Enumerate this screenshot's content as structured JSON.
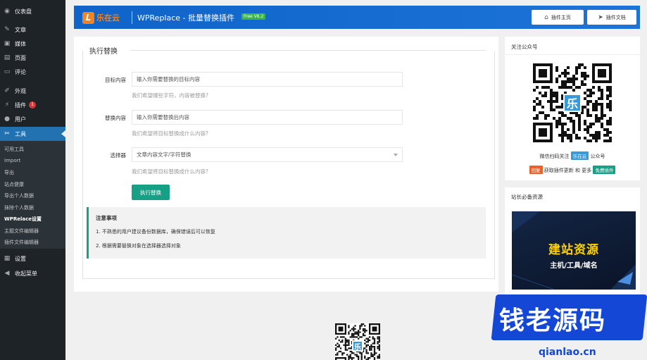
{
  "sidebar": {
    "items": [
      {
        "label": "仪表盘",
        "icon": "dashboard-icon"
      },
      {
        "label": "文章",
        "icon": "pin-icon"
      },
      {
        "label": "媒体",
        "icon": "media-icon"
      },
      {
        "label": "页面",
        "icon": "page-icon"
      },
      {
        "label": "评论",
        "icon": "comment-icon"
      },
      {
        "label": "外观",
        "icon": "brush-icon"
      },
      {
        "label": "插件",
        "icon": "plugin-icon",
        "badge": "1"
      },
      {
        "label": "用户",
        "icon": "user-icon"
      },
      {
        "label": "工具",
        "icon": "wrench-icon",
        "active": true
      },
      {
        "label": "设置",
        "icon": "settings-icon"
      },
      {
        "label": "收起菜单",
        "icon": "collapse-icon"
      }
    ],
    "submenu": [
      "可用工具",
      "Import",
      "导出",
      "站点健康",
      "导出个人数据",
      "抹除个人数据",
      "WPRelace设置",
      "主题文件编辑器",
      "插件文件编辑器"
    ]
  },
  "header": {
    "logo_letter": "L",
    "logo_text": "乐在云",
    "title": "WPReplace - 批量替换插件",
    "version": "Free V6.2",
    "home_btn": "插件主页",
    "docs_btn": "插件文档"
  },
  "main": {
    "section_title": "执行替换",
    "target": {
      "label": "目标内容",
      "placeholder": "输入你需要替换的目标内容",
      "help": "我们希望哪些字符，内容被替换?"
    },
    "replace": {
      "label": "替换内容",
      "placeholder": "输入你需要替换后内容",
      "help": "我们希望将目标替换成什么内容?"
    },
    "selector": {
      "label": "选择器",
      "value": "文章内容文字/字符替换",
      "help": "我们希望将目标替换成什么内容?"
    },
    "run_btn": "执行替换",
    "notice": {
      "title": "注意事项",
      "items": [
        "1. 不熟悉的用户建议备份数据库，确保错误后可以恢复",
        "2. 根据需要替换对象在选择器选择对象"
      ]
    }
  },
  "wechat_card": {
    "title": "关注公众号",
    "qr_center": "乐",
    "scan_prefix": "微信扫码关注",
    "scan_tag": "乐在云",
    "scan_suffix": "公众号",
    "perk_tag": "回复",
    "perk_text": "获取插件更新 和 更多",
    "perk_badge": "免费插件"
  },
  "resource_card": {
    "title": "站长必备资源",
    "banner_title": "建站资源",
    "banner_sub": "主机/工具/域名"
  },
  "watermark": {
    "text": "钱老源码",
    "url": "qianlao.cn"
  },
  "colors": {
    "sidebar_bg": "#1d2327",
    "active_blue": "#2271b1",
    "header_blue": "#1d74d8",
    "accent_green": "#16a085",
    "logo_orange": "#f58220"
  }
}
